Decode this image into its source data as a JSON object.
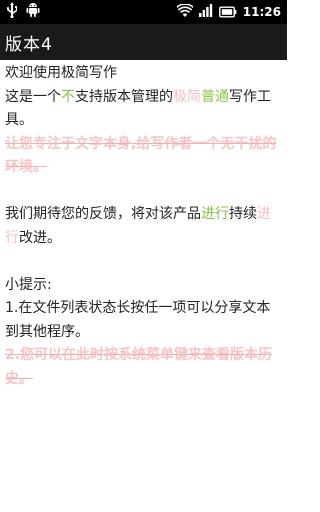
{
  "status_bar": {
    "time": "11:26",
    "icons": [
      "usb-icon",
      "android-icon",
      "wifi-icon",
      "signal-icon",
      "battery-icon"
    ]
  },
  "title_bar": {
    "title": "版本4"
  },
  "document": {
    "line1": "欢迎使用极简写作",
    "line2_a": "这是一个",
    "line2_b": "不",
    "line2_c": "支持版本管理的",
    "line2_d": "极简",
    "line2_e": "普通",
    "line2_f": "写作工具。",
    "line3_strike": "让您专注于文字本身,给写作者一个无干扰的环境。",
    "line4_a": "我们期待您的反馈，将对该产品",
    "line4_b": "进行",
    "line4_c": "持续",
    "line4_d": "进行",
    "line4_e": "改进。",
    "tip_title": "小提示:",
    "tip1": "1.在文件列表状态长按任一项可以分享文本到其他程序。",
    "tip2_strike": "2.您可以在此时按系统菜单键来查看版本历史。"
  },
  "colors": {
    "added": "#8bc34a",
    "deleted": "#f5c1c1",
    "title_bar": "#1a1a1a",
    "status_bar": "#000000"
  }
}
